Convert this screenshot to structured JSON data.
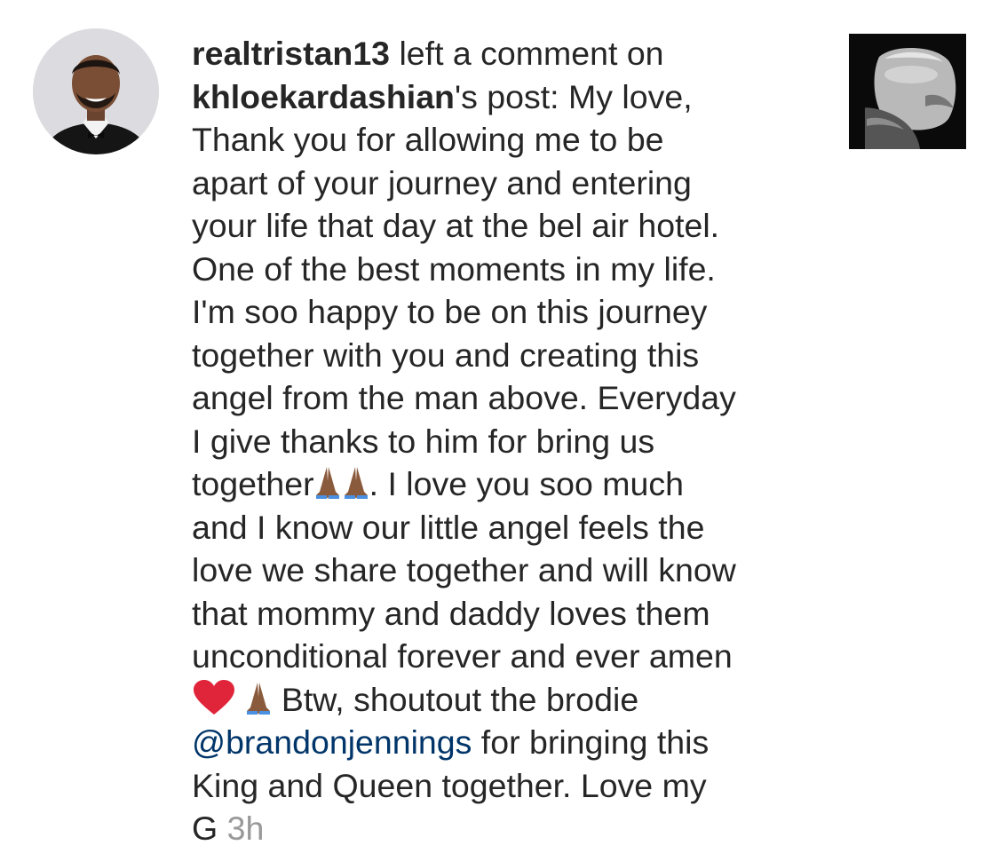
{
  "notification": {
    "actor": "realtristan13",
    "action": " left a comment on",
    "target_user": "khloekardashian",
    "target_suffix": "'s post: My love,",
    "lines": [
      "Thank you for allowing me to be",
      "apart of your journey and entering",
      "your life that day at the bel air hotel.",
      "One of the best moments in my life.",
      "I'm soo happy to be on this journey",
      "together with you and creating this",
      "angel from the man above. Everyday",
      "I give thanks to him for bring us"
    ],
    "line_together": "together",
    "line_together_rest": ". I love you soo much",
    "lines2": [
      "and I know our little angel feels the",
      "love we share together and will know",
      "that mommy and daddy loves them",
      "unconditional forever and ever amen"
    ],
    "line_btw": " Btw, shoutout the brodie",
    "mention": "@brandonjennings",
    "mention_rest": " for bringing this",
    "line_king": "King and Queen together. Love my",
    "last_word": "G",
    "timestamp": "3h",
    "emoji": {
      "praying": "folded-hands-emoji",
      "heart": "red-heart-emoji"
    }
  },
  "colors": {
    "text": "#262626",
    "mention": "#003569",
    "timestamp": "#999999",
    "heart": "#e0243a",
    "skin": "#8a5a3c"
  }
}
